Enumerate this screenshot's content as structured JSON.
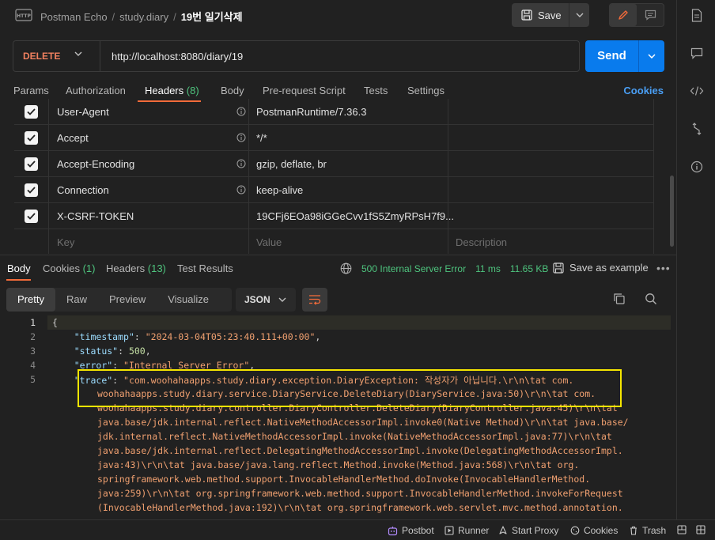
{
  "breadcrumb": {
    "workspace": "Postman Echo",
    "collection": "study.diary",
    "request": "19번 일기삭제"
  },
  "toolbar": {
    "save_label": "Save"
  },
  "request": {
    "method": "DELETE",
    "url": "http://localhost:8080/diary/19",
    "send_label": "Send"
  },
  "req_tabs": {
    "params": "Params",
    "authorization": "Authorization",
    "headers": "Headers",
    "headers_count": "(8)",
    "body": "Body",
    "prerequest": "Pre-request Script",
    "tests": "Tests",
    "settings": "Settings",
    "cookies": "Cookies"
  },
  "headers": [
    {
      "key": "User-Agent",
      "value": "PostmanRuntime/7.36.3"
    },
    {
      "key": "Accept",
      "value": "*/*"
    },
    {
      "key": "Accept-Encoding",
      "value": "gzip, deflate, br"
    },
    {
      "key": "Connection",
      "value": "keep-alive"
    },
    {
      "key": "X-CSRF-TOKEN",
      "value": "19CFj6EOa98iGGeCvv1fS5ZmyRPsH7f9..."
    }
  ],
  "headers_placeholder": {
    "key": "Key",
    "value": "Value",
    "description": "Description"
  },
  "resp_tabs": {
    "body": "Body",
    "cookies": "Cookies",
    "cookies_count": "(1)",
    "headers": "Headers",
    "headers_count": "(13)",
    "test_results": "Test Results"
  },
  "response_status": {
    "status": "500 Internal Server Error",
    "time": "11 ms",
    "size": "11.65 KB",
    "save_example": "Save as example"
  },
  "view_modes": {
    "pretty": "Pretty",
    "raw": "Raw",
    "preview": "Preview",
    "visualize": "Visualize"
  },
  "format": "JSON",
  "code": {
    "line_numbers": [
      "1",
      "2",
      "3",
      "4",
      "5"
    ],
    "timestamp_key": "\"timestamp\"",
    "timestamp_val": "\"2024-03-04T05:23:40.111+00:00\"",
    "status_key": "\"status\"",
    "status_val": "500",
    "error_key": "\"error\"",
    "error_val": "\"Internal Server Error\"",
    "trace_key": "\"trace\"",
    "trace_lines": [
      "\"com.woohahaapps.study.diary.exception.DiaryException: 작성자가 아닙니다.\\r\\n\\tat com.",
      "woohahaapps.study.diary.service.DiaryService.DeleteDiary(DiaryService.java:50)\\r\\n\\tat com.",
      "woohahaapps.study.diary.controller.DiaryController.DeleteDiary(DiaryController.java:45)\\r\\n\\tat",
      "java.base/jdk.internal.reflect.NativeMethodAccessorImpl.invoke0(Native Method)\\r\\n\\tat java.base/",
      "jdk.internal.reflect.NativeMethodAccessorImpl.invoke(NativeMethodAccessorImpl.java:77)\\r\\n\\tat",
      "java.base/jdk.internal.reflect.DelegatingMethodAccessorImpl.invoke(DelegatingMethodAccessorImpl.",
      "java:43)\\r\\n\\tat java.base/java.lang.reflect.Method.invoke(Method.java:568)\\r\\n\\tat org.",
      "springframework.web.method.support.InvocableHandlerMethod.doInvoke(InvocableHandlerMethod.",
      "java:259)\\r\\n\\tat org.springframework.web.method.support.InvocableHandlerMethod.invokeForRequest",
      "(InvocableHandlerMethod.java:192)\\r\\n\\tat org.springframework.web.servlet.mvc.method.annotation."
    ]
  },
  "statusbar": {
    "postbot": "Postbot",
    "runner": "Runner",
    "start_proxy": "Start Proxy",
    "cookies": "Cookies",
    "trash": "Trash"
  },
  "colors": {
    "accent": "#f26b3a",
    "send": "#097bed",
    "success": "#4ec47e",
    "method": "#f0805f",
    "highlight": "#f5e500"
  }
}
